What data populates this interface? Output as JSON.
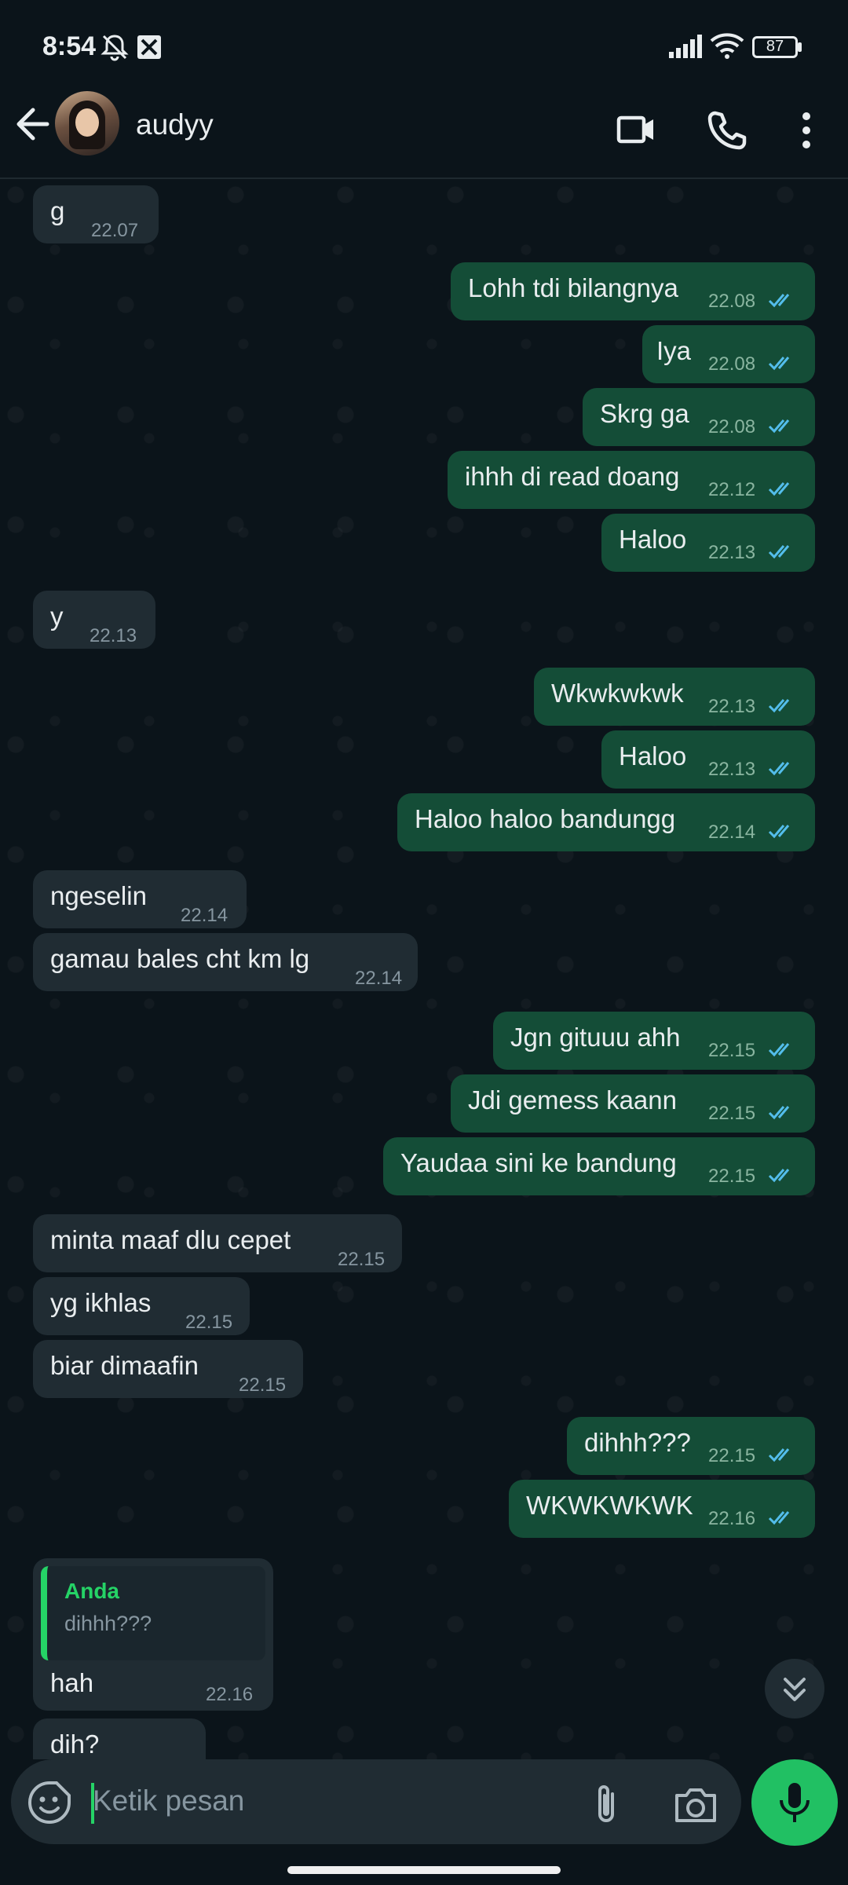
{
  "status_bar": {
    "time": "8:54",
    "battery": "87"
  },
  "header": {
    "contact_name": "audyy"
  },
  "messages": [
    {
      "dir": "in",
      "text": "g",
      "time": "22.07"
    },
    {
      "dir": "out",
      "text": "Lohh tdi bilangnya",
      "time": "22.08"
    },
    {
      "dir": "out",
      "text": "Iya",
      "time": "22.08"
    },
    {
      "dir": "out",
      "text": "Skrg ga",
      "time": "22.08"
    },
    {
      "dir": "out",
      "text": "ihhh di read doang",
      "time": "22.12"
    },
    {
      "dir": "out",
      "text": "Haloo",
      "time": "22.13"
    },
    {
      "dir": "in",
      "text": "y",
      "time": "22.13"
    },
    {
      "dir": "out",
      "text": "Wkwkwkwk",
      "time": "22.13"
    },
    {
      "dir": "out",
      "text": "Haloo",
      "time": "22.13"
    },
    {
      "dir": "out",
      "text": "Haloo haloo bandungg",
      "time": "22.14"
    },
    {
      "dir": "in",
      "text": "ngeselin",
      "time": "22.14"
    },
    {
      "dir": "in",
      "text": "gamau bales cht km lg",
      "time": "22.14"
    },
    {
      "dir": "out",
      "text": "Jgn gituuu ahh",
      "time": "22.15"
    },
    {
      "dir": "out",
      "text": "Jdi gemess kaann",
      "time": "22.15"
    },
    {
      "dir": "out",
      "text": "Yaudaa sini ke bandung",
      "time": "22.15"
    },
    {
      "dir": "in",
      "text": "minta maaf dlu cepet",
      "time": "22.15"
    },
    {
      "dir": "in",
      "text": "yg ikhlas",
      "time": "22.15"
    },
    {
      "dir": "in",
      "text": "biar dimaafin",
      "time": "22.15"
    },
    {
      "dir": "out",
      "text": "dihhh???",
      "time": "22.15"
    },
    {
      "dir": "out",
      "text": "WKWKWKWK",
      "time": "22.16"
    },
    {
      "dir": "in",
      "text": "hah",
      "time": "22.16",
      "reply_to": {
        "name": "Anda",
        "text": "dihhh???"
      }
    },
    {
      "dir": "in",
      "text": "dih?",
      "time": ""
    }
  ],
  "composer": {
    "placeholder": "Ketik pesan"
  },
  "colors": {
    "accent": "#25d366",
    "outgoing": "#144d37",
    "incoming": "#202c33",
    "read_ticks": "#53bdeb"
  }
}
